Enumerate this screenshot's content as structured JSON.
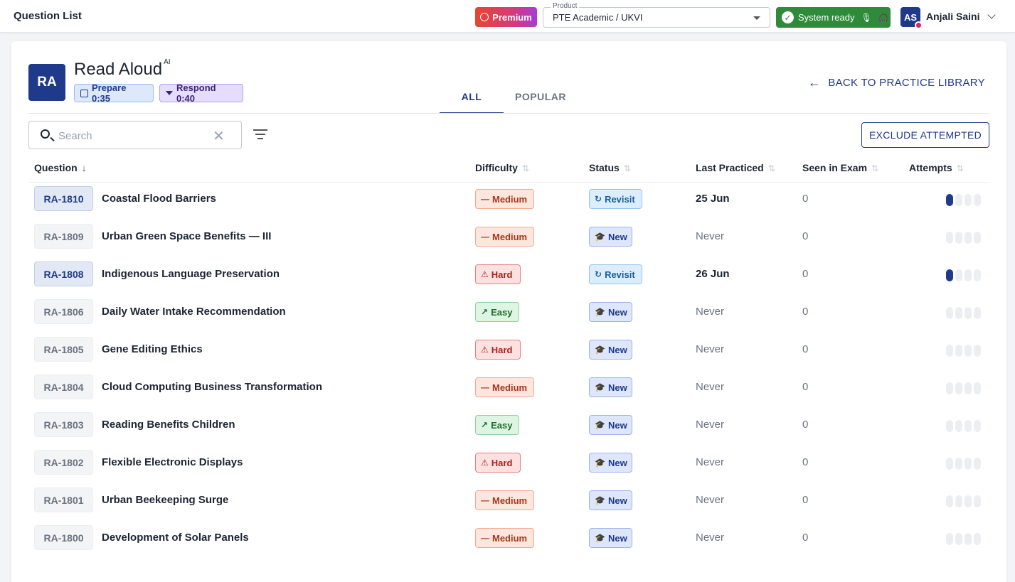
{
  "header": {
    "title": "Question List",
    "premium_label": "Premium",
    "product": {
      "legend": "Product",
      "value": "PTE Academic / UKVI"
    },
    "system_status": "System ready",
    "user": {
      "initials": "AS",
      "name": "Anjali Saini"
    }
  },
  "task": {
    "code": "RA",
    "title": "Read Aloud",
    "title_badge": "AI",
    "prepare": "Prepare 0:35",
    "respond": "Respond 0:40"
  },
  "tabs": [
    {
      "label": "ALL",
      "active": true
    },
    {
      "label": "POPULAR",
      "active": false
    }
  ],
  "back_link": "BACK TO PRACTICE LIBRARY",
  "search": {
    "placeholder": "Search",
    "value": ""
  },
  "exclude_button": "EXCLUDE ATTEMPTED",
  "columns": [
    "Question",
    "Difficulty",
    "Status",
    "Last Practiced",
    "Seen in Exam",
    "Attempts"
  ],
  "rows": [
    {
      "id": "RA-1810",
      "name": "Coastal Flood Barriers",
      "difficulty": "Medium",
      "status": "Revisit",
      "last": "25 Jun",
      "seen": "0",
      "attempts": 1
    },
    {
      "id": "RA-1809",
      "name": "Urban Green Space Benefits — III",
      "difficulty": "Medium",
      "status": "New",
      "last": "Never",
      "seen": "0",
      "attempts": 0
    },
    {
      "id": "RA-1808",
      "name": "Indigenous Language Preservation",
      "difficulty": "Hard",
      "status": "Revisit",
      "last": "26 Jun",
      "seen": "0",
      "attempts": 1
    },
    {
      "id": "RA-1806",
      "name": "Daily Water Intake Recommendation",
      "difficulty": "Easy",
      "status": "New",
      "last": "Never",
      "seen": "0",
      "attempts": 0
    },
    {
      "id": "RA-1805",
      "name": "Gene Editing Ethics",
      "difficulty": "Hard",
      "status": "New",
      "last": "Never",
      "seen": "0",
      "attempts": 0
    },
    {
      "id": "RA-1804",
      "name": "Cloud Computing Business Transformation",
      "difficulty": "Medium",
      "status": "New",
      "last": "Never",
      "seen": "0",
      "attempts": 0
    },
    {
      "id": "RA-1803",
      "name": "Reading Benefits Children",
      "difficulty": "Easy",
      "status": "New",
      "last": "Never",
      "seen": "0",
      "attempts": 0
    },
    {
      "id": "RA-1802",
      "name": "Flexible Electronic Displays",
      "difficulty": "Hard",
      "status": "New",
      "last": "Never",
      "seen": "0",
      "attempts": 0
    },
    {
      "id": "RA-1801",
      "name": "Urban Beekeeping Surge",
      "difficulty": "Medium",
      "status": "New",
      "last": "Never",
      "seen": "0",
      "attempts": 0
    },
    {
      "id": "RA-1800",
      "name": "Development of Solar Panels",
      "difficulty": "Medium",
      "status": "New",
      "last": "Never",
      "seen": "0",
      "attempts": 0
    }
  ],
  "colors": {
    "brand": "#1f3a8a",
    "ready": "#2e8b3a",
    "medium": "#a5381b",
    "hard": "#b01f1f",
    "easy": "#1f6d30"
  }
}
